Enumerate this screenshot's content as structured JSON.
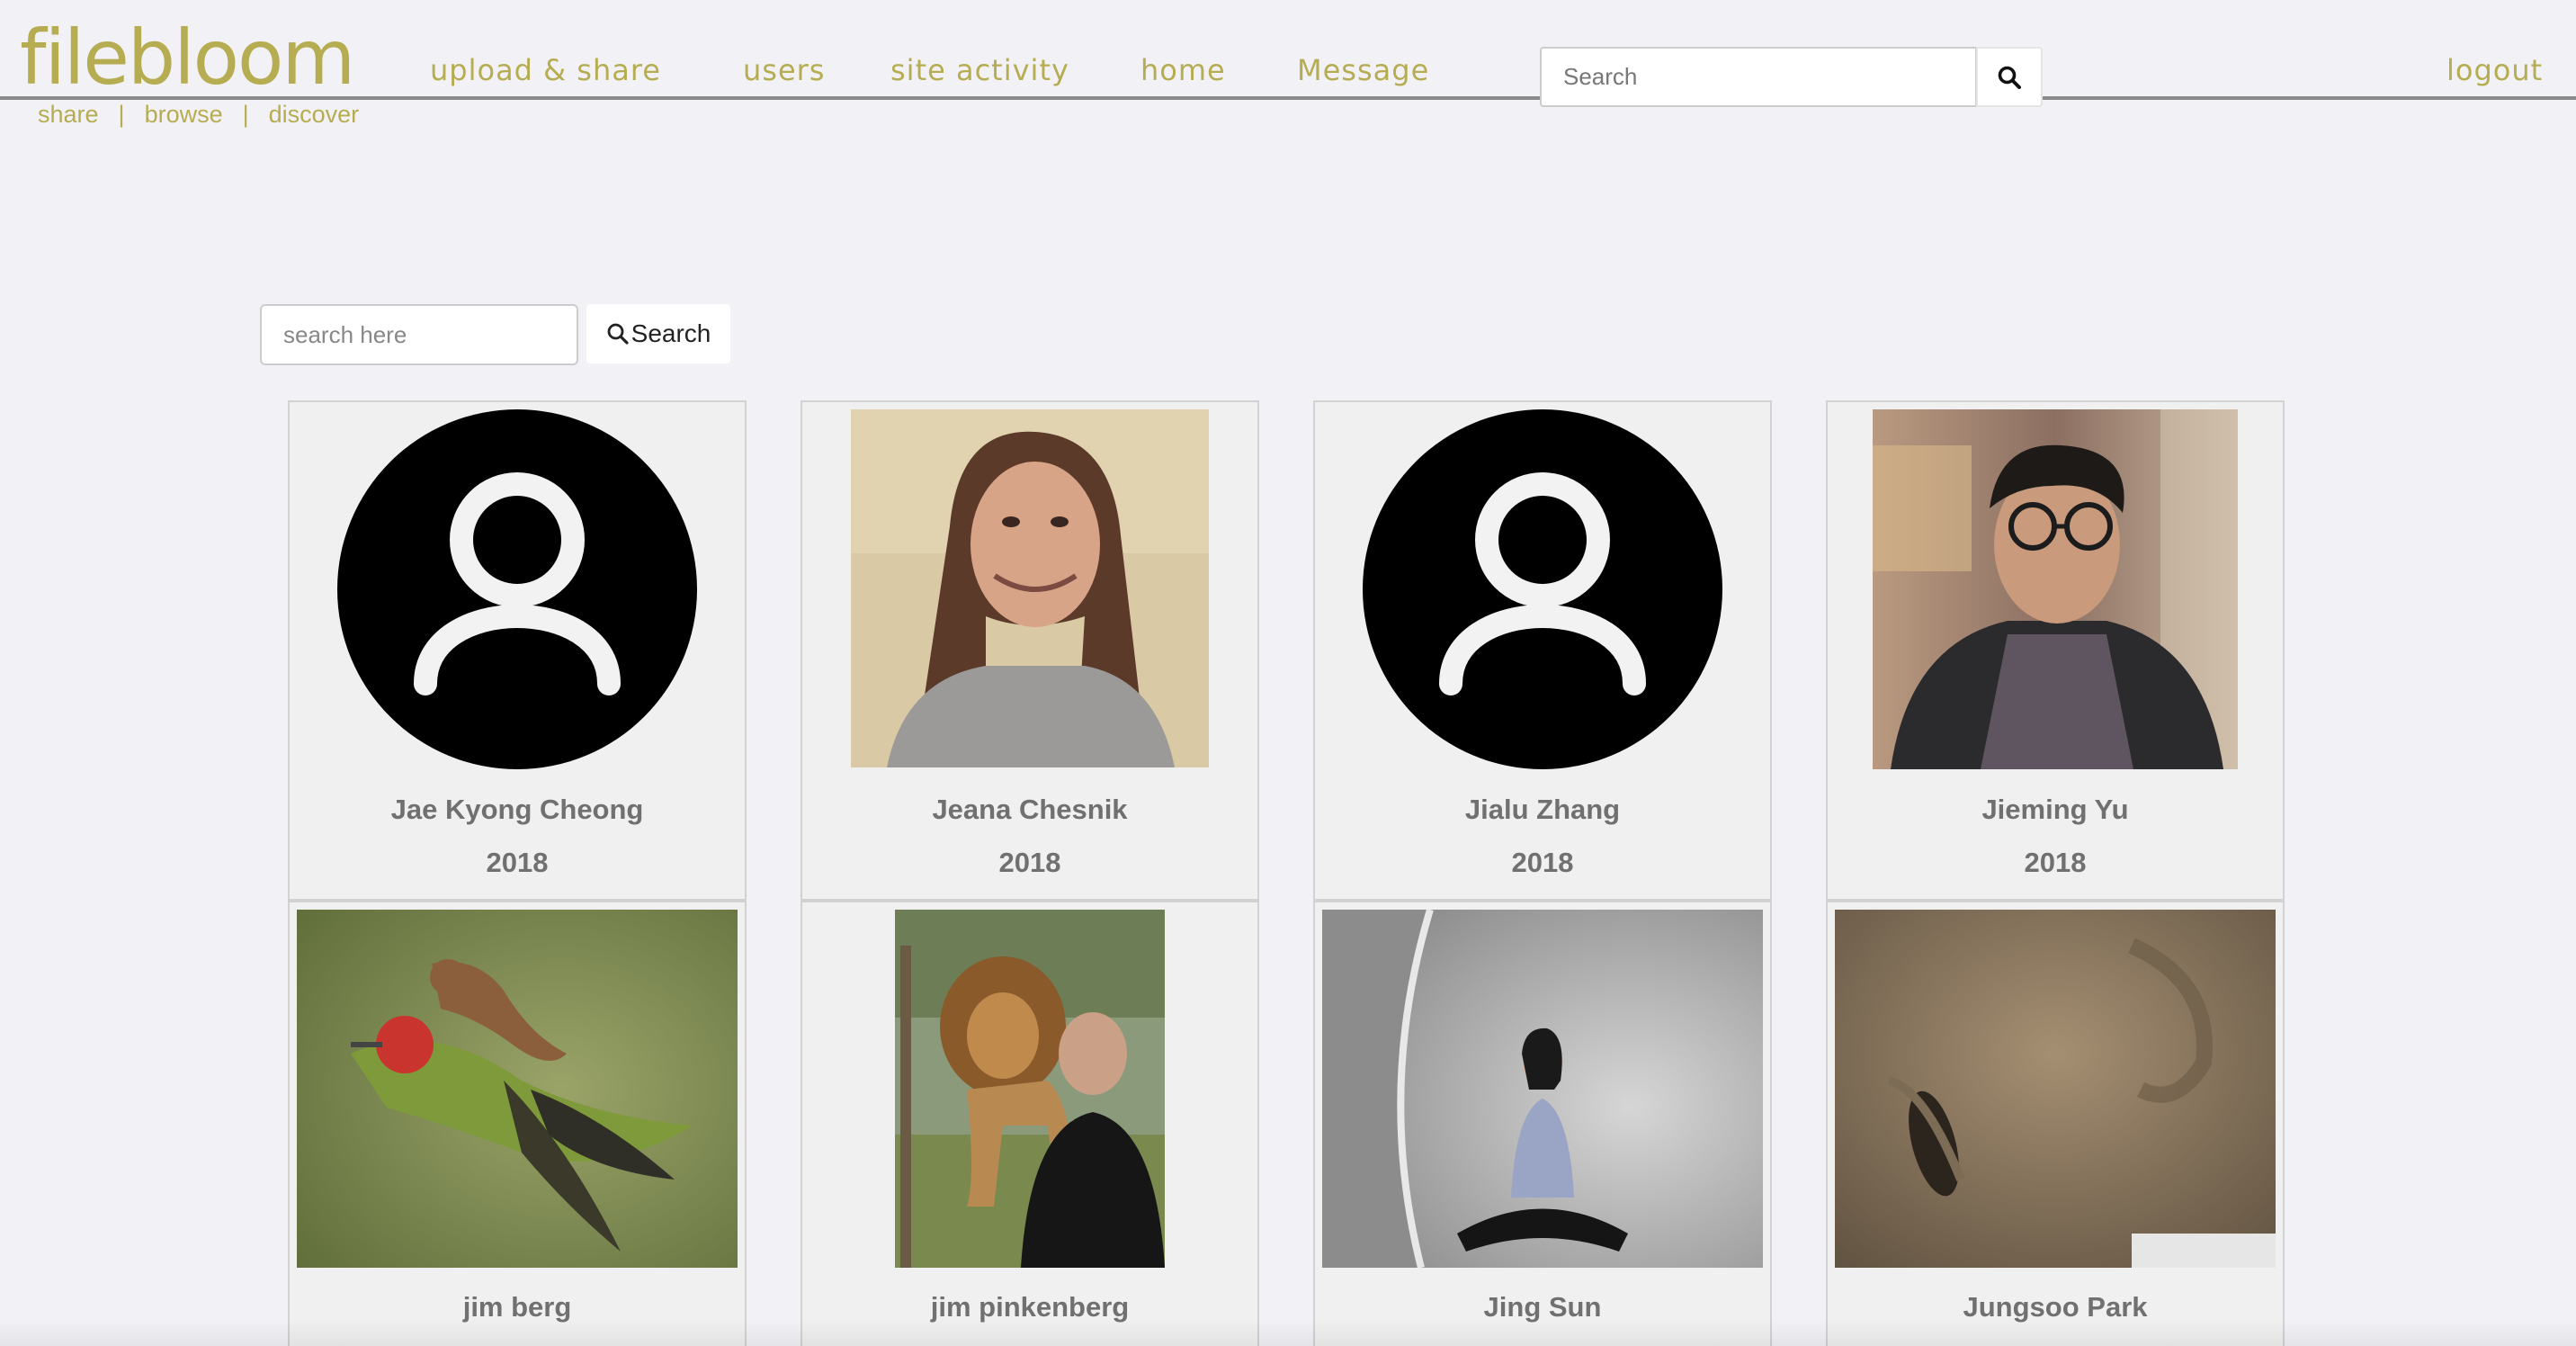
{
  "header": {
    "logo": "filebloom",
    "tagline": [
      "share",
      "browse",
      "discover"
    ],
    "nav": [
      {
        "label": "upload & share"
      },
      {
        "label": "users"
      },
      {
        "label": "site activity"
      },
      {
        "label": "home"
      },
      {
        "label": "Message"
      }
    ],
    "search_placeholder": "Search",
    "search_icon": "search-icon",
    "logout": "logout"
  },
  "user_search": {
    "placeholder": "search here",
    "button_label": "Search",
    "button_icon": "search-icon"
  },
  "users": [
    {
      "name": "Jae Kyong Cheong",
      "year": "2018",
      "photo": "default-avatar-icon"
    },
    {
      "name": "Jeana Chesnik",
      "year": "2018",
      "photo": "portrait-woman"
    },
    {
      "name": "Jialu Zhang",
      "year": "2018",
      "photo": "default-avatar-icon"
    },
    {
      "name": "Jieming Yu",
      "year": "2018",
      "photo": "portrait-man-glasses"
    },
    {
      "name": "jim berg",
      "photo": "weasel-on-woodpecker"
    },
    {
      "name": "jim pinkenberg",
      "photo": "man-with-lion"
    },
    {
      "name": "Jing Sun",
      "photo": "woman-sitting-in-tunnel"
    },
    {
      "name": "Jungsoo Park",
      "photo": "closeup-face"
    }
  ],
  "colors": {
    "brand": "#b6ad52",
    "background": "#f2f2f6",
    "card": "#f0f0f0",
    "card_text": "#707070"
  }
}
